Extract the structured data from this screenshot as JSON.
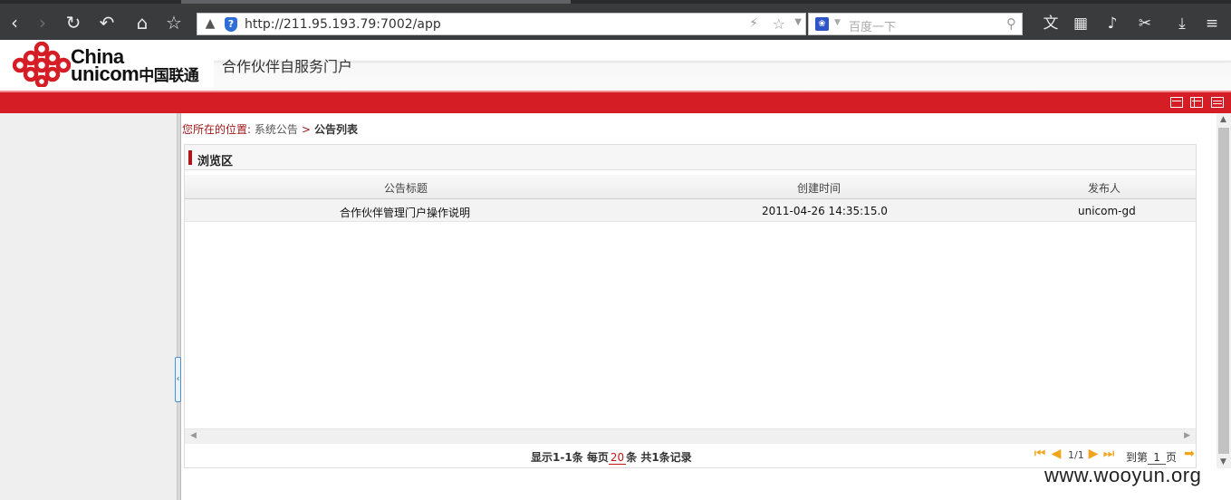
{
  "browser": {
    "url": "http://211.95.193.79:7002/app",
    "search_placeholder": "百度一下"
  },
  "portal": {
    "logo_en_1": "China",
    "logo_en_2": "unicom",
    "logo_cn": "中国联通",
    "title": "合作伙伴自服务门户",
    "accent": "#d41d24"
  },
  "breadcrumb": {
    "label": "您所在的位置:",
    "parent": "系统公告",
    "separator": ">",
    "current": "公告列表"
  },
  "panel": {
    "title": "浏览区"
  },
  "table": {
    "columns": [
      "公告标题",
      "创建时间",
      "发布人"
    ],
    "rows": [
      [
        "合作伙伴管理门户操作说明",
        "2011-04-26 14:35:15.0",
        "unicom-gd"
      ]
    ]
  },
  "pager": {
    "show_prefix": "显示1-1条 每页",
    "per_page": "20",
    "show_suffix": "条 共1条记录",
    "page_info": "1/1",
    "goto_prefix": "到第",
    "goto_value": "1",
    "goto_suffix": "页"
  },
  "watermark": "www.wooyun.org"
}
